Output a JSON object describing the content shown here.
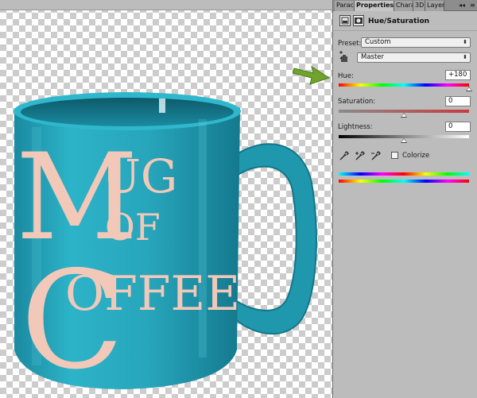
{
  "canvas": {
    "mug_text": {
      "line1_initial": "M",
      "line1_rest": "UG",
      "line2": "OF",
      "line3_initial": "C",
      "line3_rest": "OFFEE"
    }
  },
  "panel_tabs": [
    "Parac",
    "Properties",
    "Chara",
    "3D",
    "Layer"
  ],
  "panel_controls": {
    "collapse": "◂◂",
    "menu": "≡"
  },
  "adjustment": {
    "title": "Hue/Saturation",
    "preset_label": "Preset:",
    "preset_value": "Custom",
    "channel_value": "Master",
    "hue_label": "Hue:",
    "hue_value": "+180",
    "hue_level": 1.0,
    "saturation_label": "Saturation:",
    "saturation_value": "0",
    "saturation_level": 0.5,
    "lightness_label": "Lightness:",
    "lightness_value": "0",
    "lightness_level": 0.5,
    "colorize_label": "Colorize",
    "colorize_checked": false
  },
  "colors": {
    "mug": "#26a3b9",
    "arrow": "#6fa32b",
    "letters": "#f2c9b9"
  },
  "icons": [
    "hand-target-icon",
    "eyedropper-icon",
    "eyedropper-plus-icon",
    "eyedropper-minus-icon",
    "adjustment-layer-icon",
    "mask-icon",
    "arrow-icon"
  ]
}
